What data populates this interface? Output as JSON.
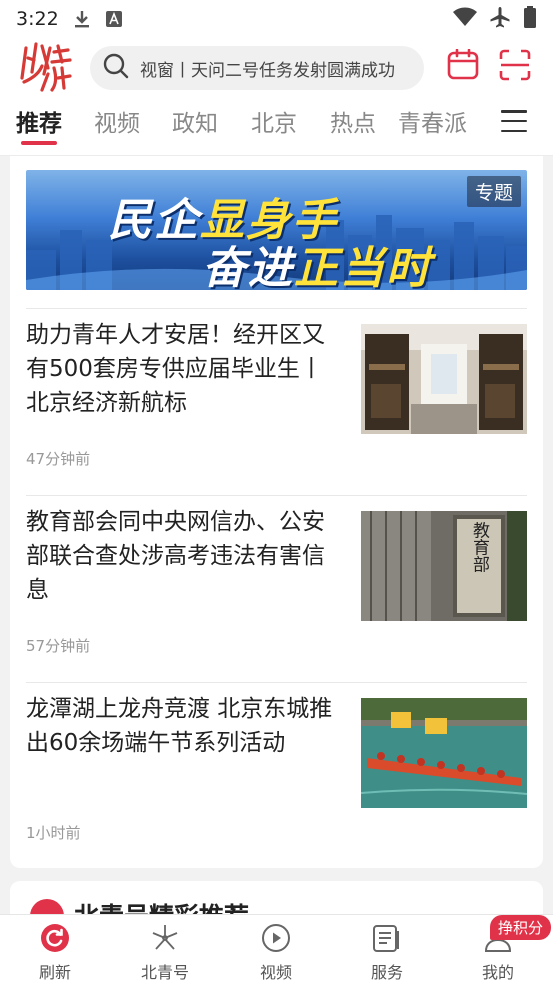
{
  "status_bar": {
    "time": "3:22"
  },
  "header": {
    "logo_alt": "北青",
    "search_placeholder": "视窗丨天问二号任务发射圆满成功"
  },
  "tabs": [
    {
      "label": "推荐",
      "active": true
    },
    {
      "label": "视频"
    },
    {
      "label": "政知"
    },
    {
      "label": "北京"
    },
    {
      "label": "热点"
    },
    {
      "label": "青春派"
    }
  ],
  "banner": {
    "line1_a": "民企",
    "line1_b": "显身手",
    "line2_a": "奋进",
    "line2_b": "正当时",
    "tag": "专题"
  },
  "articles": [
    {
      "title": "助力青年人才安居！经开区又有500套房专供应届毕业生丨北京经济新航标",
      "time": "47分钟前"
    },
    {
      "title": "教育部会同中央网信办、公安部联合查处涉高考违法有害信息",
      "time": "57分钟前"
    },
    {
      "title": "龙潭湖上龙舟竞渡 北京东城推出60余场端午节系列活动",
      "time": "1小时前"
    }
  ],
  "thumb2_sign": "教育部",
  "section2": {
    "title": "北青号精彩推荐"
  },
  "bottom_nav": [
    {
      "label": "刷新",
      "icon": "refresh-icon",
      "active": true
    },
    {
      "label": "北青号",
      "icon": "flower-icon"
    },
    {
      "label": "视频",
      "icon": "play-icon"
    },
    {
      "label": "服务",
      "icon": "service-icon"
    },
    {
      "label": "我的",
      "icon": "user-icon"
    }
  ],
  "points_badge": "挣积分",
  "colors": {
    "accent": "#e0334a",
    "banner_highlight": "#ffe23a"
  }
}
